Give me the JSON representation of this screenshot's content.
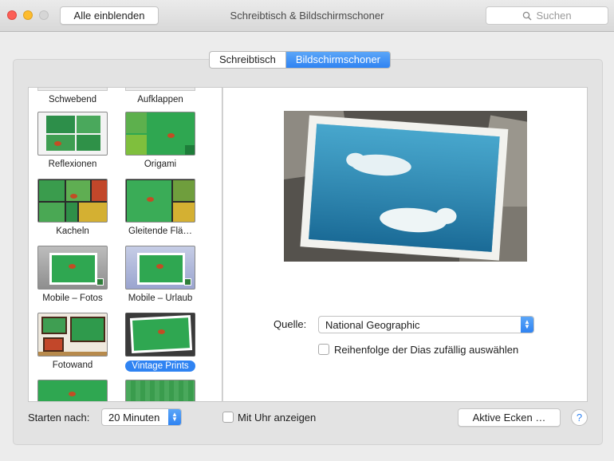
{
  "window": {
    "title": "Schreibtisch & Bildschirmschoner",
    "show_all_label": "Alle einblenden",
    "search_placeholder": "Suchen"
  },
  "tabs": [
    {
      "label": "Schreibtisch",
      "active": false
    },
    {
      "label": "Bildschirmschoner",
      "active": true
    }
  ],
  "savers": [
    {
      "label": "Schwebend"
    },
    {
      "label": "Aufklappen"
    },
    {
      "label": "Reflexionen"
    },
    {
      "label": "Origami"
    },
    {
      "label": "Kacheln"
    },
    {
      "label": "Gleitende Flä…"
    },
    {
      "label": "Mobile – Fotos"
    },
    {
      "label": "Mobile – Urlaub"
    },
    {
      "label": "Fotowand"
    },
    {
      "label": "Vintage Prints",
      "selected": true
    }
  ],
  "options": {
    "source_label": "Quelle:",
    "source_value": "National Geographic",
    "shuffle_label": "Reihenfolge der Dias zufällig auswählen",
    "shuffle_checked": false
  },
  "footer": {
    "start_after_label": "Starten nach:",
    "start_after_value": "20 Minuten",
    "show_clock_label": "Mit Uhr anzeigen",
    "show_clock_checked": false,
    "hot_corners_label": "Aktive Ecken …",
    "help_label": "?"
  },
  "colors": {
    "accent": "#2f83f2",
    "close": "#fc5f57",
    "minimize": "#fdbc2e"
  }
}
